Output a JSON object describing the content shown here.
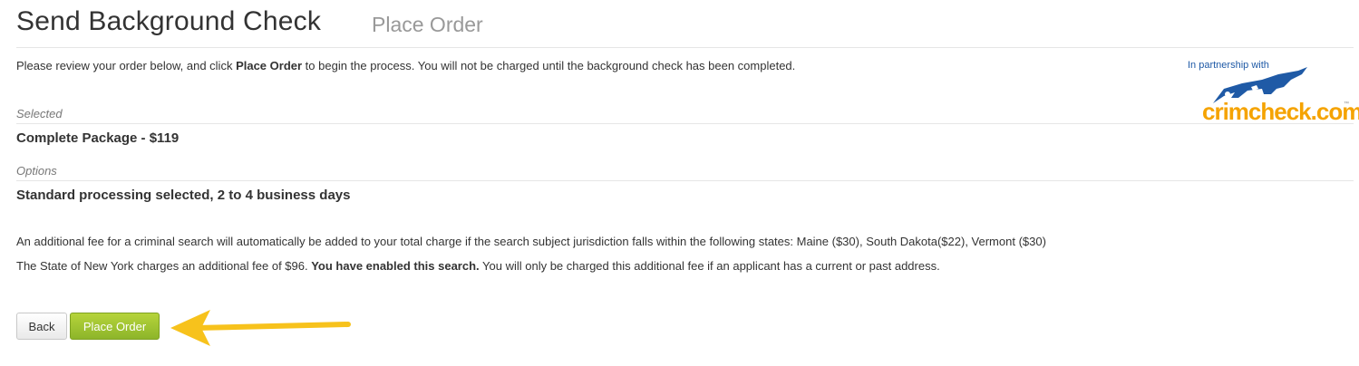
{
  "header": {
    "title": "Send Background Check",
    "subtitle": "Place Order"
  },
  "intro": {
    "before": "Please review your order below, and click ",
    "bold": "Place Order",
    "after": " to begin the process. You will not be charged until the background check has been completed."
  },
  "selected": {
    "label": "Selected",
    "value": "Complete Package - $119"
  },
  "options": {
    "label": "Options",
    "value": "Standard processing selected, 2 to 4 business days"
  },
  "notes": {
    "fee_line": "An additional fee for a criminal search will automatically be added to your total charge if the search subject jurisdiction falls within the following states: Maine ($30), South Dakota($22), Vermont ($30)",
    "ny_before": "The State of New York charges an additional fee of $96. ",
    "ny_bold": "You have enabled this search.",
    "ny_after": " You will only be charged this additional fee if an applicant has a current or past address."
  },
  "logo": {
    "caption": "In partnership with",
    "wordmark": "crimcheck.com",
    "tm": "™",
    "brand_blue": "#1f5aa6",
    "brand_orange": "#f5a300"
  },
  "actions": {
    "back_label": "Back",
    "place_order_label": "Place Order",
    "place_order_color": "#9ec431",
    "arrow_color": "#f7c21c"
  }
}
